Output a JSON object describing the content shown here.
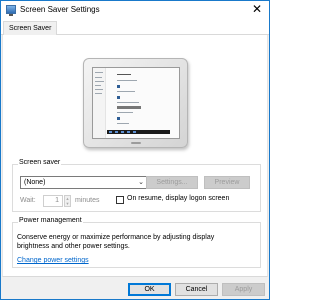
{
  "window": {
    "title": "Screen Saver Settings"
  },
  "tabs": [
    {
      "label": "Screen Saver"
    }
  ],
  "screen_saver": {
    "group_label": "Screen saver",
    "selected": "(None)",
    "settings_label": "Settings...",
    "preview_label": "Preview",
    "wait_label": "Wait:",
    "wait_value": "1",
    "minutes_label": "minutes",
    "resume_label": "On resume, display logon screen"
  },
  "power": {
    "group_label": "Power management",
    "description": "Conserve energy or maximize performance by adjusting display brightness and other power settings.",
    "link": "Change power settings"
  },
  "footer": {
    "ok": "OK",
    "cancel": "Cancel",
    "apply": "Apply"
  },
  "colors": {
    "accent": "#0078d7",
    "link": "#0066cc",
    "border": "#1979ca"
  }
}
